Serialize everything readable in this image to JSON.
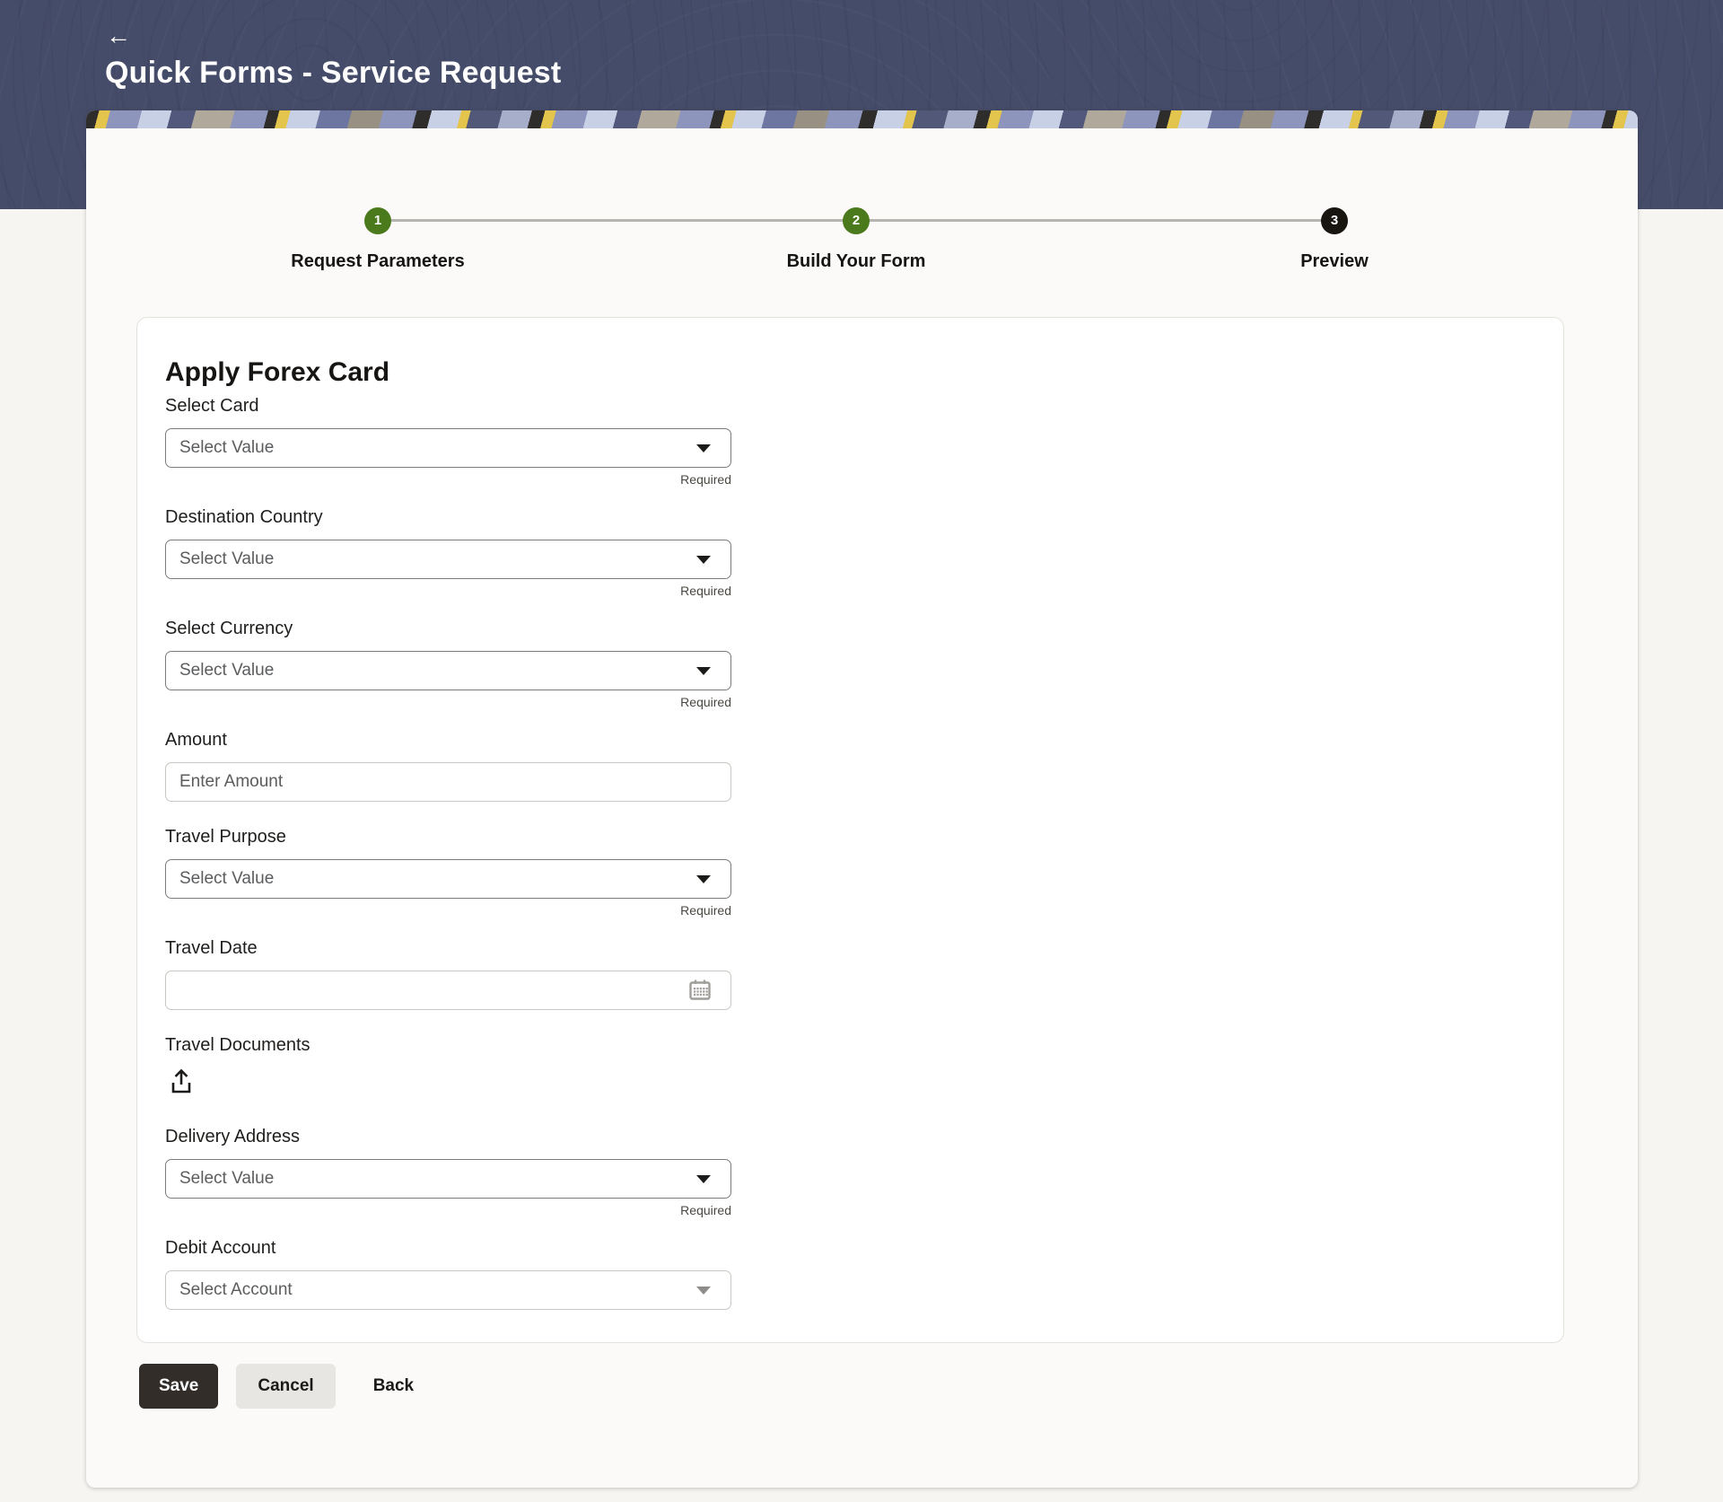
{
  "header": {
    "title": "Quick Forms - Service Request",
    "back_icon_glyph": "←"
  },
  "stepper": {
    "steps": [
      {
        "number": "1",
        "label": "Request Parameters",
        "state": "complete"
      },
      {
        "number": "2",
        "label": "Build Your Form",
        "state": "complete"
      },
      {
        "number": "3",
        "label": "Preview",
        "state": "current"
      }
    ]
  },
  "form": {
    "title": "Apply Forex Card",
    "fields": [
      {
        "label": "Select Card",
        "type": "select",
        "placeholder": "Select Value",
        "required_text": "Required"
      },
      {
        "label": "Destination Country",
        "type": "select",
        "placeholder": "Select Value",
        "required_text": "Required"
      },
      {
        "label": "Select Currency",
        "type": "select",
        "placeholder": "Select Value",
        "required_text": "Required"
      },
      {
        "label": "Amount",
        "type": "text",
        "placeholder": "Enter Amount",
        "required_text": ""
      },
      {
        "label": "Travel Purpose",
        "type": "select",
        "placeholder": "Select Value",
        "required_text": "Required"
      },
      {
        "label": "Travel Date",
        "type": "date",
        "placeholder": "",
        "required_text": ""
      },
      {
        "label": "Travel Documents",
        "type": "upload",
        "placeholder": "",
        "required_text": ""
      },
      {
        "label": "Delivery Address",
        "type": "select",
        "placeholder": "Select Value",
        "required_text": "Required"
      },
      {
        "label": "Debit Account",
        "type": "select",
        "placeholder": "Select Account",
        "required_text": ""
      }
    ],
    "buttons": {
      "save": "Save",
      "cancel": "Cancel",
      "back": "Back"
    }
  },
  "icons": {
    "back": "arrow-left-icon",
    "dropdown": "chevron-down-icon",
    "calendar": "calendar-icon",
    "upload": "upload-icon"
  },
  "colors": {
    "header_bg": "#454c69",
    "step_complete": "#4a7a1b",
    "step_current": "#18140f",
    "stepper_line": "#b7b5b1",
    "save_bg": "#322d29",
    "cancel_bg": "#e8e6e3",
    "banner_yellow": "#e3c44d",
    "banner_periwinkle": "#8d95bc",
    "banner_navy": "#51587c",
    "banner_black": "#2e2d2b"
  }
}
